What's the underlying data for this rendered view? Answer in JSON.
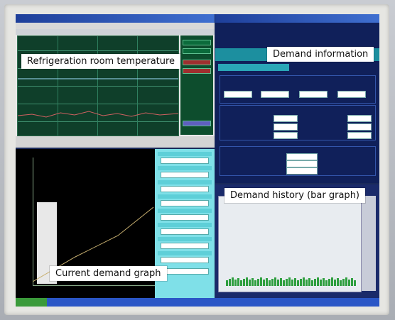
{
  "labels": {
    "refrigeration": "Refrigeration room temperature",
    "demand_info": "Demand information",
    "demand_history": "Demand history (bar graph)",
    "current_demand": "Current demand graph"
  },
  "colors": {
    "label_bg": "#ffffff",
    "screen_bg": "#1a2a5a",
    "plot_green": "#0f3f2a",
    "panel_cyan": "#7fe0e8",
    "bar_green": "#2f9f3f"
  },
  "icons": [
    "window-title-icon",
    "bar-chart-icon",
    "line-chart-icon"
  ]
}
